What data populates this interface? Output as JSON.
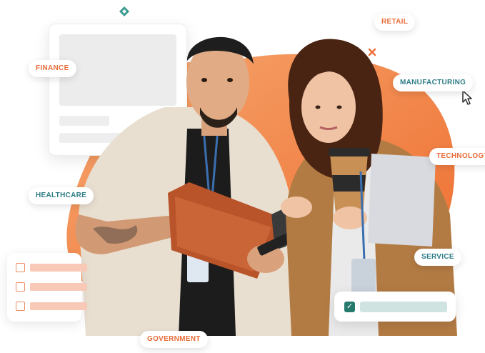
{
  "tags": {
    "finance": "FINANCE",
    "retail": "RETAIL",
    "manufacturing": "MANUFACTURING",
    "technology": "TECHNOLOGY",
    "healthcare": "HEALTHCARE",
    "service": "SERVICE",
    "government": "GOVERNMENT"
  },
  "colors": {
    "accent_orange": "#f07a3a",
    "accent_light_orange": "#f6a870",
    "teal": "#2f7d86",
    "check_green": "#267a6d"
  },
  "icons": [
    "diamond-icon",
    "x-mark-icon",
    "cursor-pointer-icon",
    "checkbox-icon",
    "checkmark-icon"
  ]
}
